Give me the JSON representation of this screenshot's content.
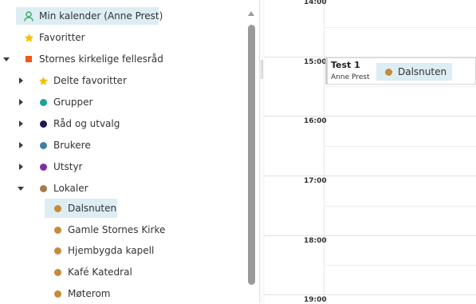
{
  "colors": {
    "selected_bg": "#dcedf3",
    "user_green": "#3aaa5e",
    "favorite_yellow": "#f2c100",
    "org_orange": "#ec5a14",
    "grupper": "#1aa39a",
    "rad_og_utvalg": "#1c1a4e",
    "brukere": "#3d7fa0",
    "utstyr": "#7b2fa6",
    "lokaler": "#a77a4c",
    "resource": "#c98a37"
  },
  "tree": {
    "my_calendar": "Min kalender (Anne Prest)",
    "favorites": "Favoritter",
    "org": "Stornes kirkelige fellesråd",
    "shared_favorites": "Delte favoritter",
    "groups": "Grupper",
    "councils": "Råd og utvalg",
    "users": "Brukere",
    "equipment": "Utstyr",
    "rooms": "Lokaler",
    "room_items": [
      "Dalsnuten",
      "Gamle Stornes Kirke",
      "Hjembygda kapell",
      "Kafé Katedral",
      "Møterom"
    ]
  },
  "calendar": {
    "times": [
      "14:00",
      "15:00",
      "16:00",
      "17:00",
      "18:00",
      "19:00"
    ],
    "event": {
      "title": "Test 1",
      "organizer": "Anne Prest",
      "resource": "Dalsnuten"
    }
  }
}
